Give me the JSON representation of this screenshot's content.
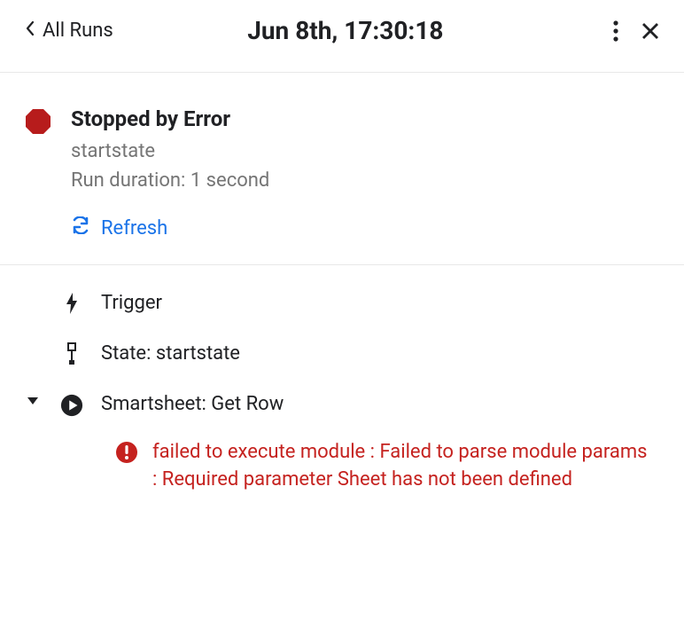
{
  "header": {
    "back_label": "All Runs",
    "title": "Jun 8th, 17:30:18"
  },
  "status": {
    "title": "Stopped by Error",
    "subtitle": "startstate",
    "duration": "Run duration: 1 second",
    "refresh_label": "Refresh"
  },
  "steps": {
    "trigger_label": "Trigger",
    "state_label": "State: startstate",
    "action_label": "Smartsheet: Get Row"
  },
  "error": {
    "message": "failed to execute module : Failed to parse module params : Required parameter Sheet has not been defined"
  }
}
